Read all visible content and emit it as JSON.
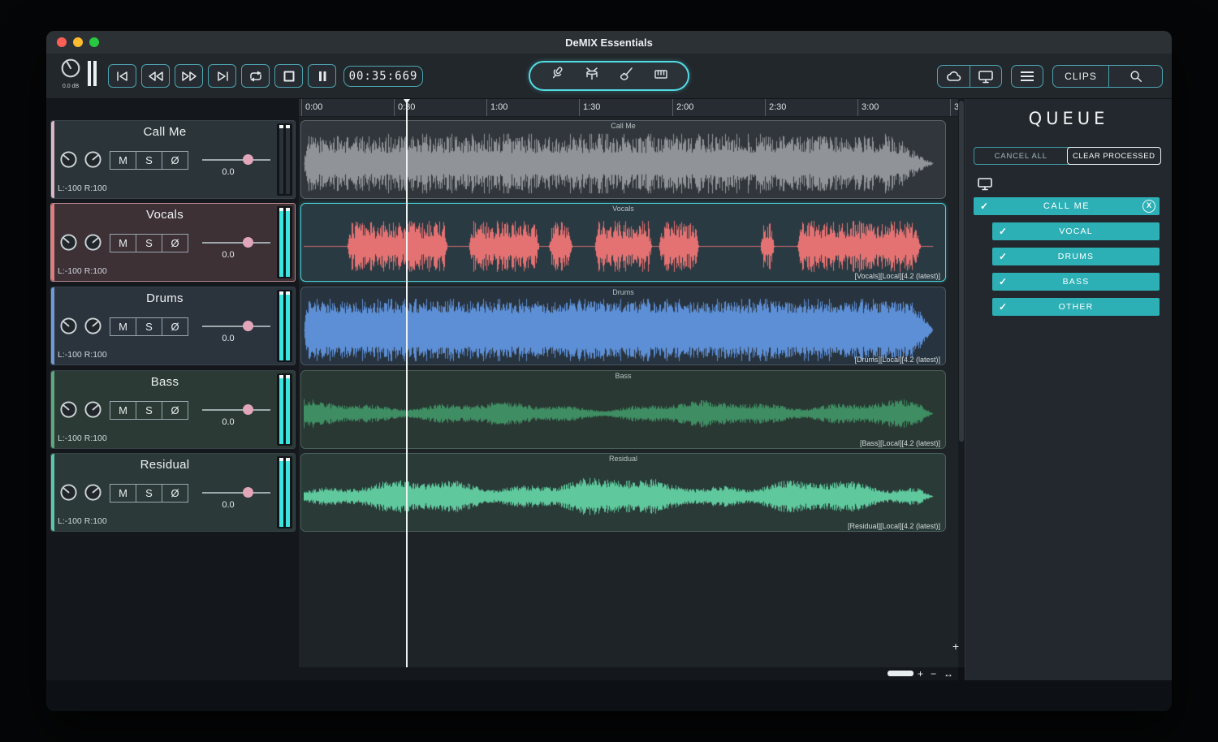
{
  "window": {
    "title": "DeMIX Essentials"
  },
  "toolbar": {
    "master_gain_label": "0.0 dB",
    "time_display": "00:35:669",
    "clips_button": "CLIPS",
    "accent": "#4da4b0",
    "pill_accent": "#52dbe3"
  },
  "timeline": {
    "ticks": [
      "0:00",
      "0:30",
      "1:00",
      "1:30",
      "2:00",
      "2:30",
      "3:00",
      "3"
    ]
  },
  "controls": {
    "mute": "M",
    "solo": "S",
    "phase": "Ø"
  },
  "tracks": [
    {
      "name": "Call Me",
      "gain": "0.0",
      "pan": "L:-100 R:100",
      "stripe": "#d9b8c4"
    },
    {
      "name": "Vocals",
      "gain": "0.0",
      "pan": "L:-100 R:100",
      "stripe": "#e07c7c"
    },
    {
      "name": "Drums",
      "gain": "0.0",
      "pan": "L:-100 R:100",
      "stripe": "#6f9bd6"
    },
    {
      "name": "Bass",
      "gain": "0.0",
      "pan": "L:-100 R:100",
      "stripe": "#5da87d"
    },
    {
      "name": "Residual",
      "gain": "0.0",
      "pan": "L:-100 R:100",
      "stripe": "#5cc7ae"
    }
  ],
  "clips": [
    {
      "title": "Call Me",
      "tag": "",
      "bg": "#30363b",
      "border": "#596168",
      "wf": {
        "color": "#909499",
        "kind": "dense",
        "amp": 0.86,
        "floor": 0.38,
        "fade": [
          0.92,
          0.985
        ]
      }
    },
    {
      "title": "Vocals",
      "tag": "[Vocals][Local][4.2 (latest)]",
      "bg": "#2a3a42",
      "border": "#4ed2da",
      "wf": {
        "color": "#e57272",
        "kind": "bursts",
        "amp": 0.8,
        "segments": [
          [
            0.068,
            0.225
          ],
          [
            0.258,
            0.368
          ],
          [
            0.383,
            0.42
          ],
          [
            0.455,
            0.545
          ],
          [
            0.555,
            0.618
          ],
          [
            0.714,
            0.736
          ],
          [
            0.772,
            0.965
          ]
        ]
      }
    },
    {
      "title": "Drums",
      "tag": "[Drums][Local][4.2 (latest)]",
      "bg": "#27333e",
      "border": "#4a5764",
      "wf": {
        "color": "#5d8fd6",
        "kind": "dense",
        "amp": 0.9,
        "floor": 0.58,
        "fade": [
          0.95,
          0.985
        ]
      }
    },
    {
      "title": "Bass",
      "tag": "[Bass][Local][4.2 (latest)]",
      "bg": "#293833",
      "border": "#4a5f56",
      "wf": {
        "color": "#3f8d63",
        "kind": "smooth",
        "amp": 0.45
      }
    },
    {
      "title": "Residual",
      "tag": "[Residual][Local][4.2 (latest)]",
      "bg": "#293a37",
      "border": "#4a5f5a",
      "wf": {
        "color": "#5fc89d",
        "kind": "smooth",
        "amp": 0.62
      }
    }
  ],
  "queue": {
    "title": "QUEUE",
    "cancel_all": "CANCEL ALL",
    "clear_processed": "CLEAR PROCESSED",
    "accent": "#2cb0b6",
    "job": {
      "label": "CALL ME",
      "close": "X"
    },
    "stems": [
      {
        "label": "VOCAL"
      },
      {
        "label": "DRUMS"
      },
      {
        "label": "BASS"
      },
      {
        "label": "OTHER"
      }
    ]
  },
  "icons": {
    "check": "✓",
    "plus": "+",
    "minus": "−",
    "fit_arrows": "↔"
  }
}
